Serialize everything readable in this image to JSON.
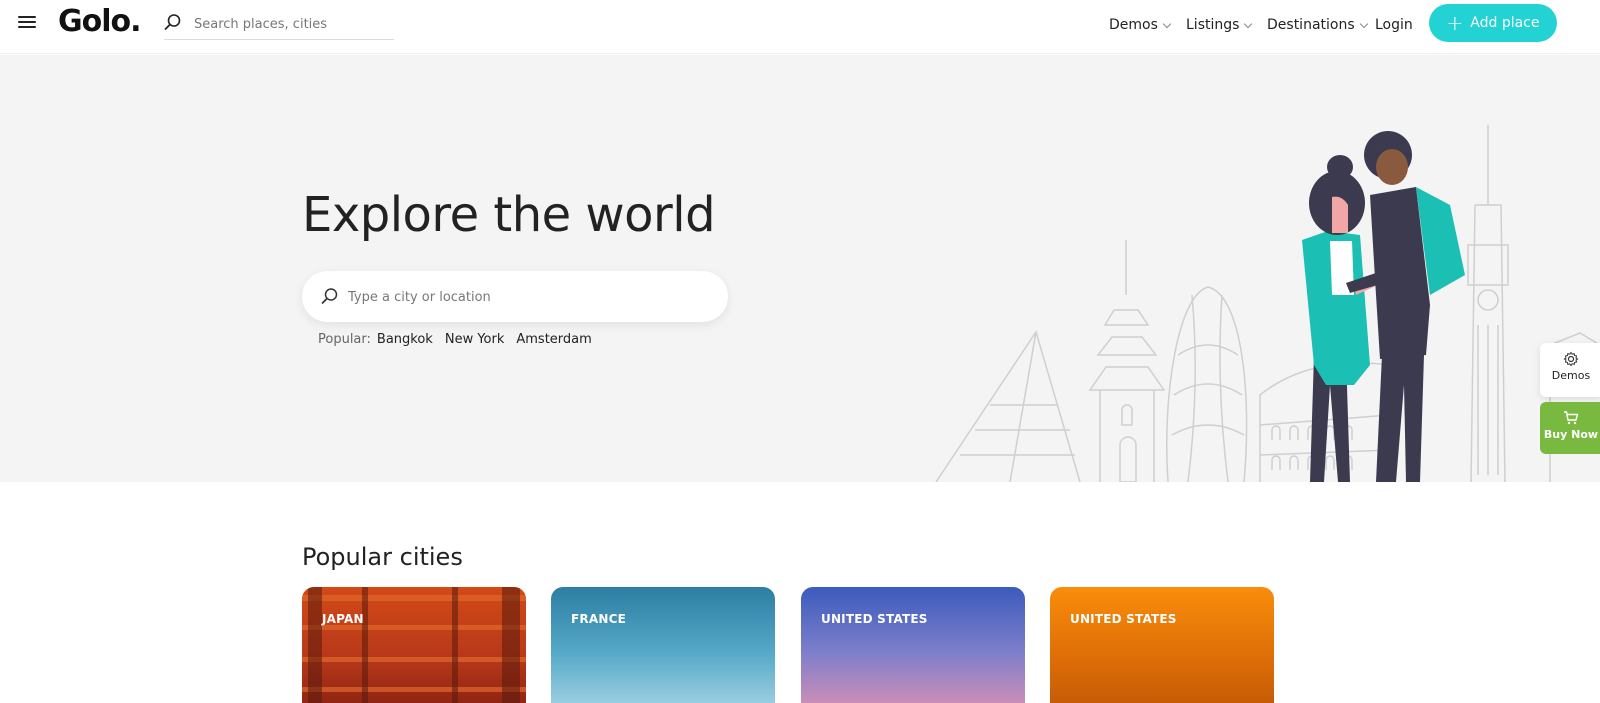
{
  "header": {
    "logo": "Golo.",
    "search_placeholder": "Search places, cities",
    "nav": [
      {
        "label": "Demos"
      },
      {
        "label": "Listings"
      },
      {
        "label": "Destinations"
      }
    ],
    "login": "Login",
    "add_place": "Add place"
  },
  "hero": {
    "title": "Explore the world",
    "search_placeholder": "Type a city or location",
    "popular_label": "Popular:",
    "popular_links": [
      "Bangkok",
      "New York",
      "Amsterdam"
    ]
  },
  "side": {
    "demos": "Demos",
    "buy_now": "Buy Now"
  },
  "popular_cities": {
    "title": "Popular cities",
    "cards": [
      {
        "country": "JAPAN"
      },
      {
        "country": "FRANCE"
      },
      {
        "country": "UNITED STATES"
      },
      {
        "country": "UNITED STATES"
      }
    ]
  },
  "colors": {
    "accent": "#23d3d3",
    "buy_green": "#7ab940",
    "hero_bg": "#f4f4f4"
  }
}
